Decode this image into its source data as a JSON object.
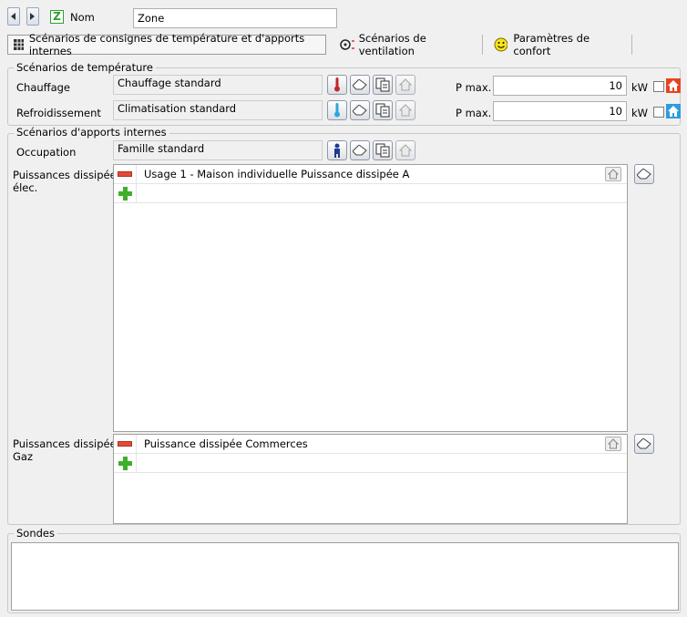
{
  "header": {
    "name_label": "Nom",
    "name_value": "Zone",
    "zone_badge": "Z"
  },
  "tabs": [
    {
      "label": "Scénarios de consignes de température et d'apports internes",
      "active": true
    },
    {
      "label": "Scénarios de ventilation",
      "active": false
    },
    {
      "label": "Paramètres de confort",
      "active": false
    }
  ],
  "temperature": {
    "title": "Scénarios de température",
    "heating": {
      "label": "Chauffage",
      "value": "Chauffage standard",
      "pmax_label": "P max.",
      "pmax": "10",
      "unit": "kW"
    },
    "cooling": {
      "label": "Refroidissement",
      "value": "Climatisation standard",
      "pmax_label": "P max.",
      "pmax": "10",
      "unit": "kW"
    }
  },
  "internal": {
    "title": "Scénarios d'apports internes",
    "occupation": {
      "label": "Occupation",
      "value": "Famille standard"
    },
    "elec": {
      "label_line1": "Puissances dissipées",
      "label_line2": "élec.",
      "items": [
        "Usage 1 - Maison individuelle Puissance dissipée A"
      ]
    },
    "gaz": {
      "label_line1": "Puissances dissipées",
      "label_line2": "Gaz",
      "items": [
        "Puissance dissipée Commerces"
      ]
    }
  },
  "sondes": {
    "title": "Sondes"
  },
  "colors": {
    "heat_icon": "#e8431f",
    "cool_icon": "#2d9be0",
    "zone_badge": "#2f9e2f"
  }
}
